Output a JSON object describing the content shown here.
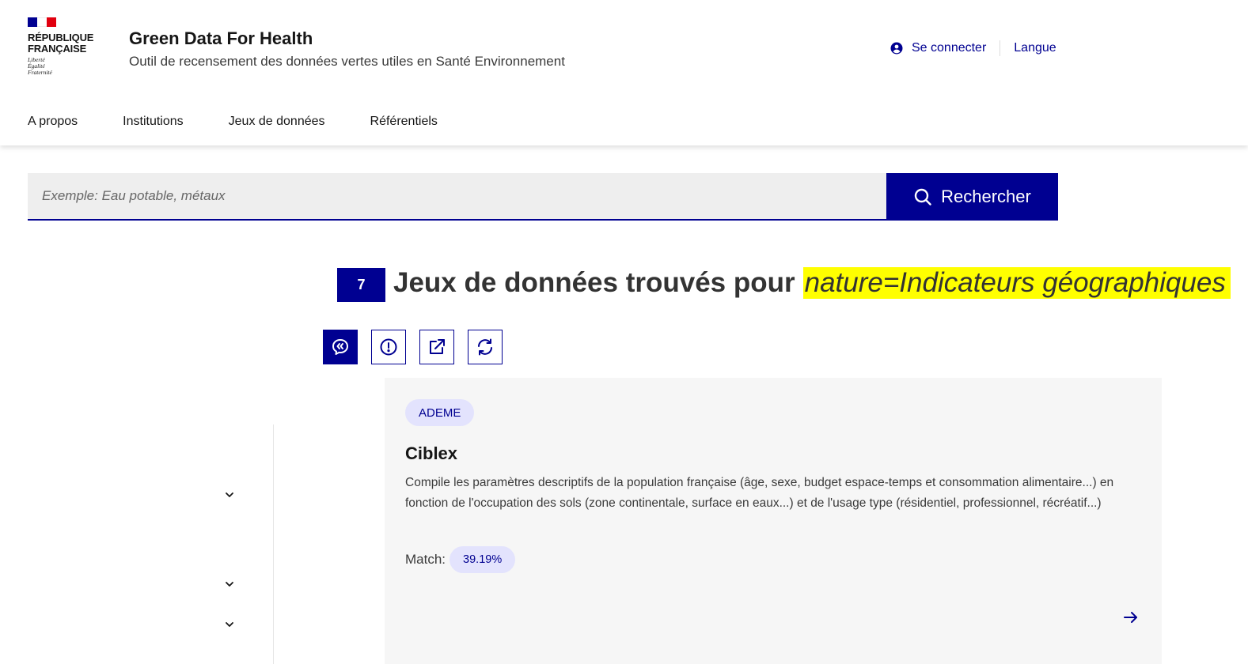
{
  "header": {
    "gov_name_line1": "RÉPUBLIQUE",
    "gov_name_line2": "FRANÇAISE",
    "motto_line1": "Liberté",
    "motto_line2": "Égalité",
    "motto_line3": "Fraternité",
    "site_title": "Green Data For Health",
    "site_subtitle": "Outil de recensement des données vertes utiles en Santé Environnement",
    "login_label": "Se connecter",
    "language_label": "Langue"
  },
  "nav": {
    "items": [
      {
        "label": "A propos"
      },
      {
        "label": "Institutions"
      },
      {
        "label": "Jeux de données"
      },
      {
        "label": "Référentiels"
      }
    ]
  },
  "search": {
    "placeholder": "Exemple: Eau potable, métaux",
    "button_label": "Rechercher"
  },
  "results": {
    "count": "7",
    "heading": "Jeux de données trouvés pour",
    "query": "nature=Indicateurs géographiques"
  },
  "actions": [
    {
      "icon": "feedback-icon"
    },
    {
      "icon": "alert-icon"
    },
    {
      "icon": "external-link-icon"
    },
    {
      "icon": "refresh-icon"
    }
  ],
  "card": {
    "tag": "ADEME",
    "title": "Ciblex",
    "description": "Compile les paramètres descriptifs de la population française (âge, sexe, budget espace-temps et consommation alimentaire...) en fonction de l'occupation des sols (zone continentale, surface en eaux...) et de l'usage type (résidentiel, professionnel, récréatif...)",
    "match_label": "Match:",
    "match_value": "39.19%"
  },
  "colors": {
    "primary": "#000091",
    "highlight": "#ffff00",
    "tag_bg": "#e3e3fd",
    "card_bg": "#f6f6f6",
    "flag_red": "#e1000f"
  }
}
